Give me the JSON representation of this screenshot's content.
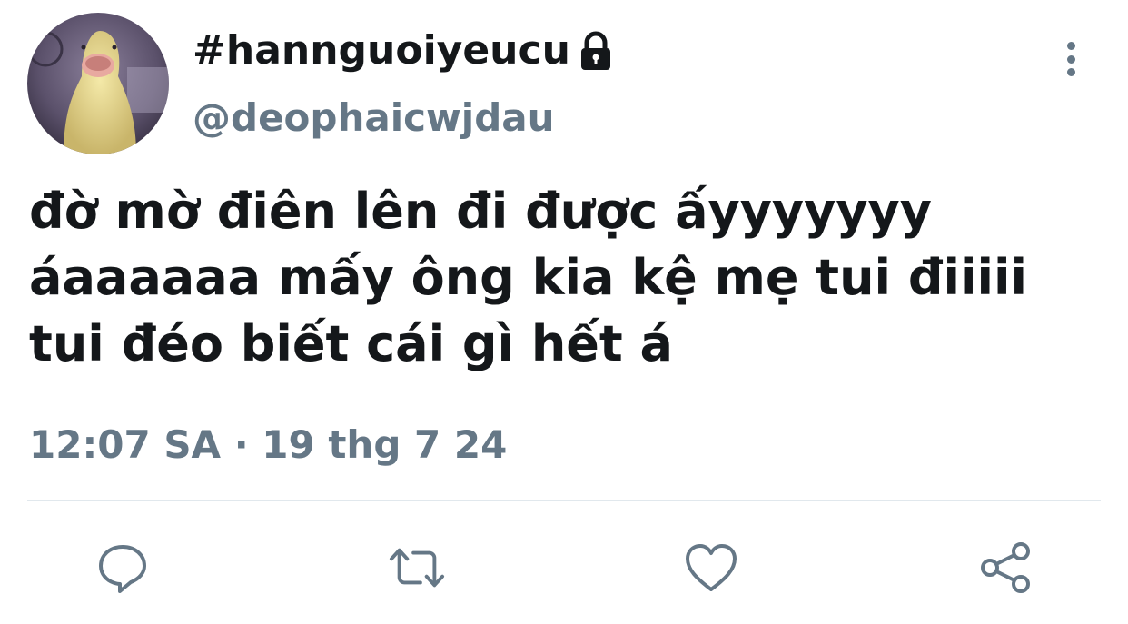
{
  "tweet": {
    "display_name": "#hannguoiyeucu",
    "handle": "@deophaicwjdau",
    "text_lines": [
      "đờ mờ điên lên đi được ấyyyyyyy",
      "áaaaaaa mấy ông kia kệ mẹ tui điiiii",
      "tui đéo biết cái gì hết á"
    ],
    "timestamp": "12:07 SA · 19 thg 7 24",
    "locked": true
  },
  "icons": {
    "lock": "lock-icon",
    "more": "more-options-icon",
    "reply": "reply-icon",
    "retweet": "retweet-icon",
    "like": "heart-icon",
    "share": "share-icon"
  },
  "colors": {
    "text_primary": "#14171a",
    "text_secondary": "#657786",
    "divider": "#e1e8ed",
    "background": "#ffffff"
  }
}
